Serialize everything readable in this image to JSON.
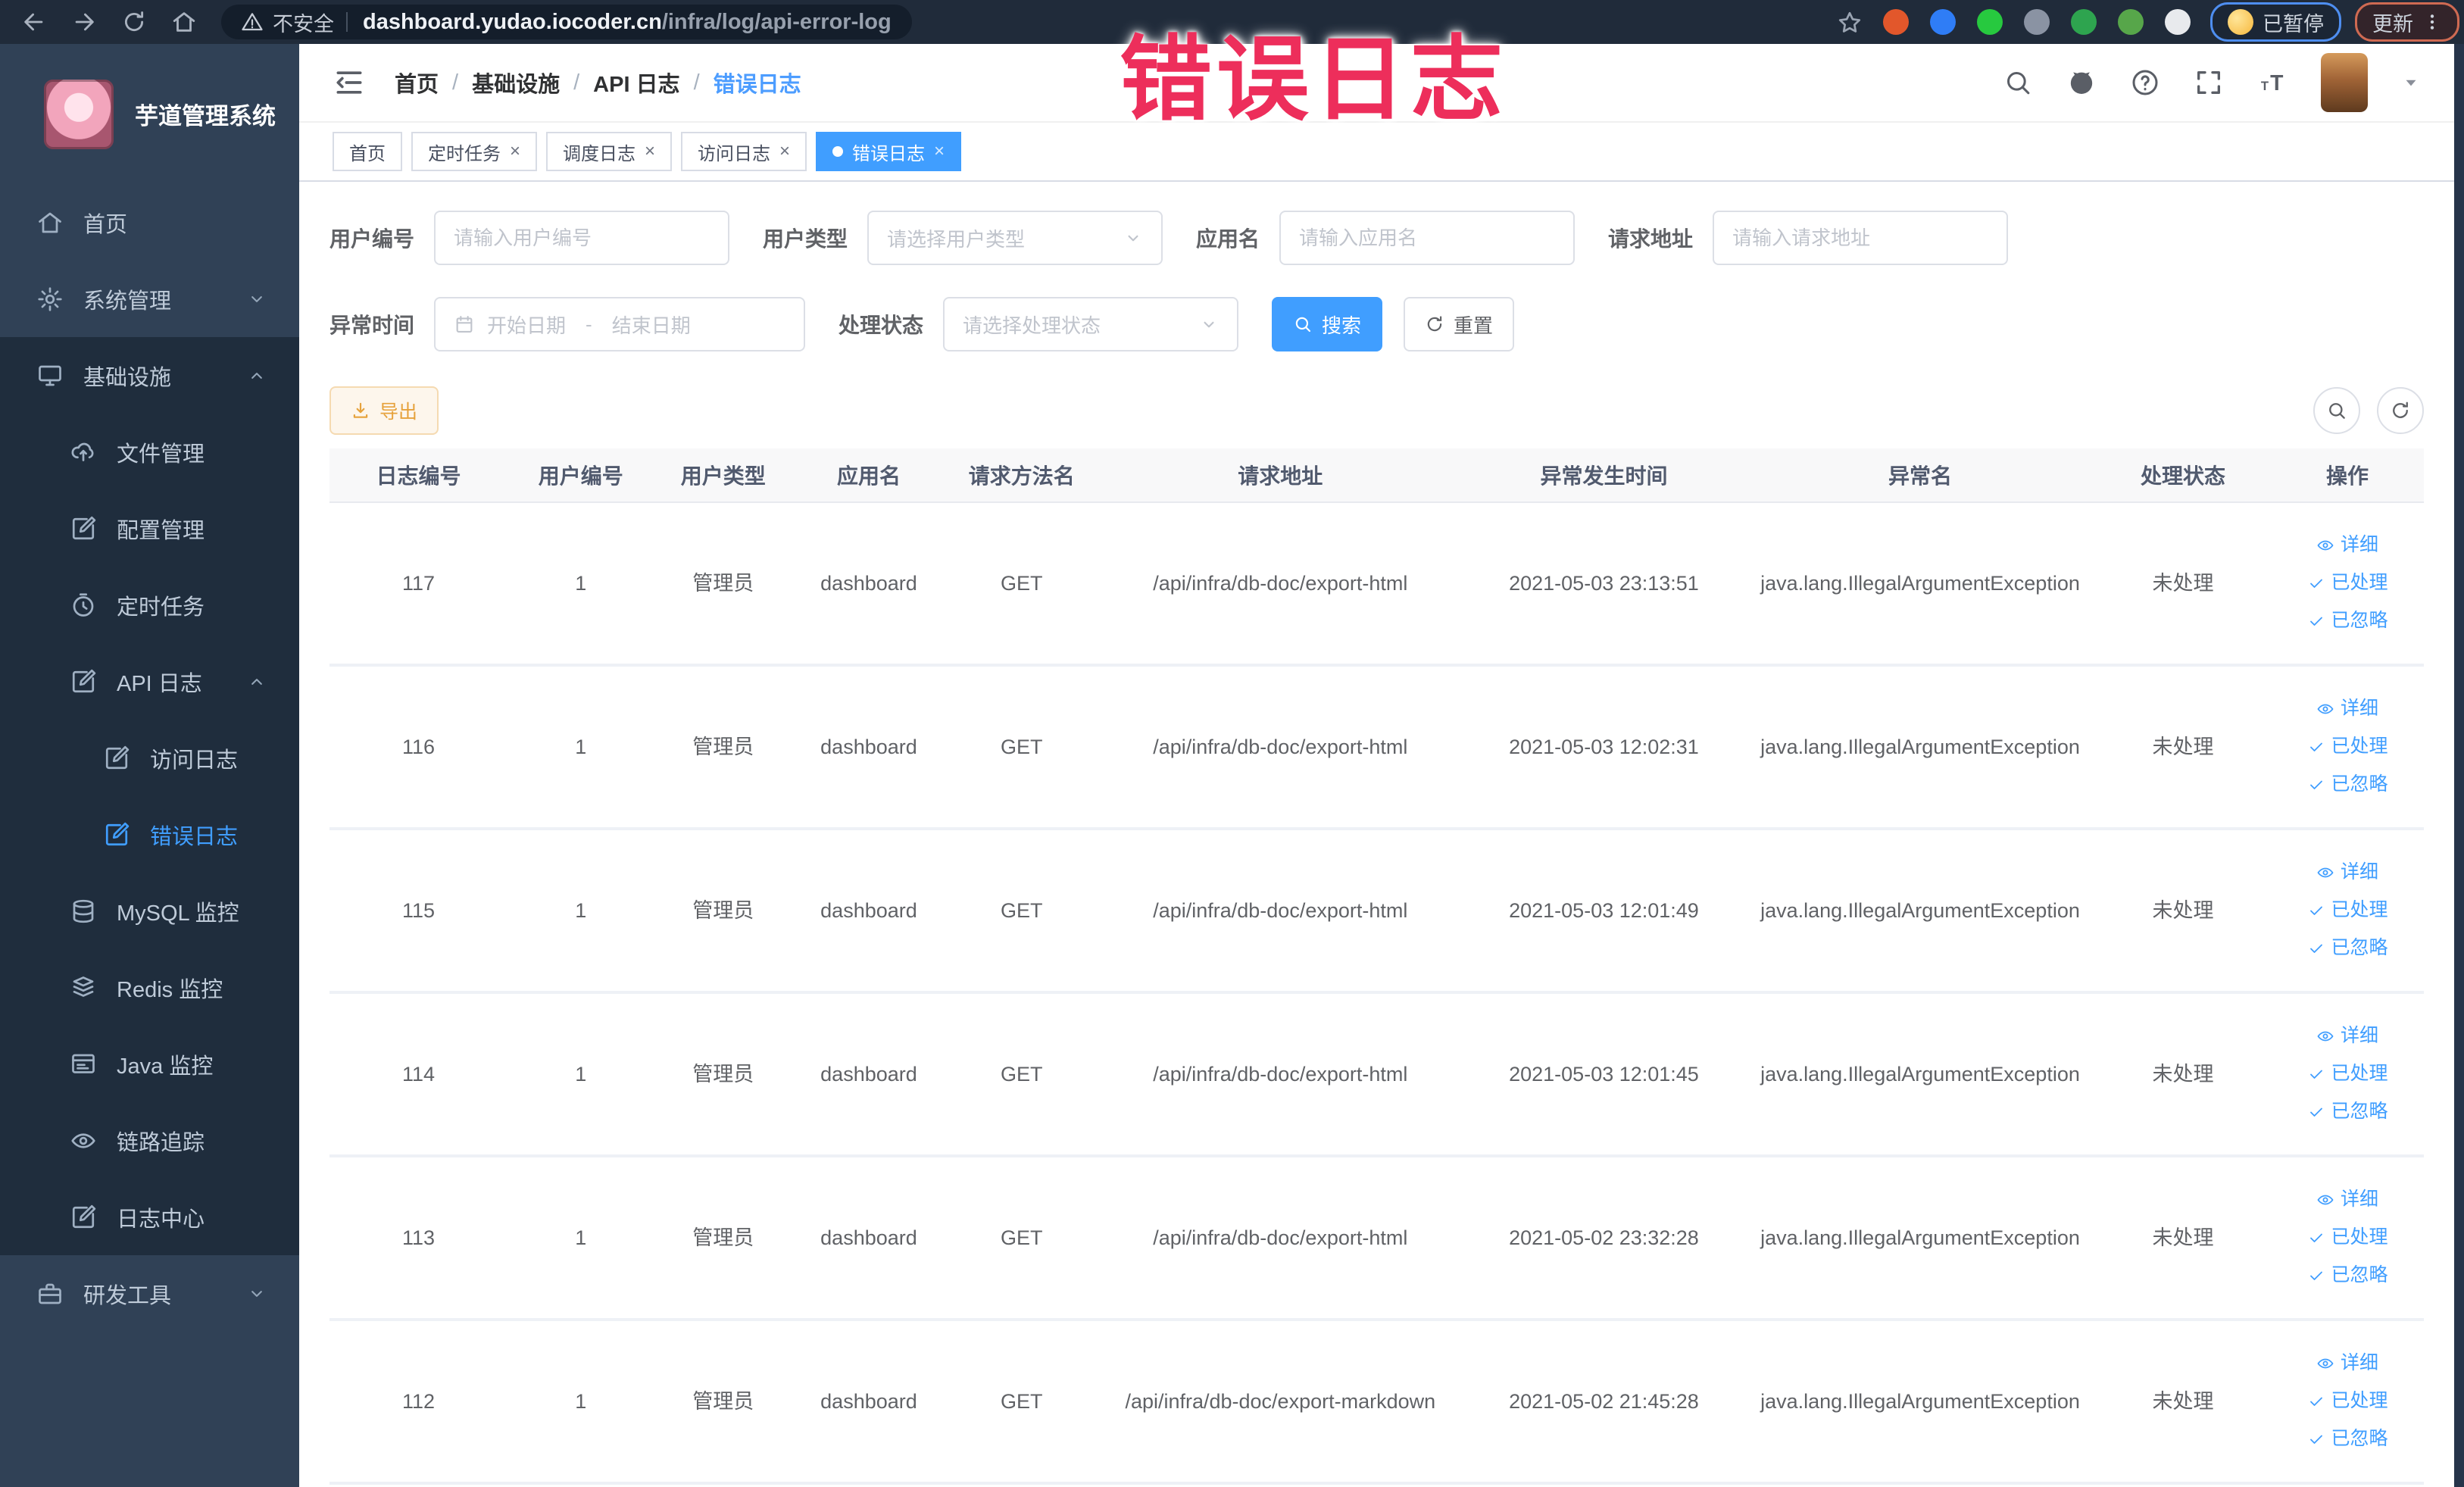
{
  "browser": {
    "security_label": "不安全",
    "url_host": "dashboard.yudao.iocoder.cn",
    "url_path": "/infra/log/api-error-log",
    "paused_badge": "已暂停",
    "update_button": "更新",
    "extension_icons": [
      {
        "name": "bookmark-star-icon",
        "color": "#9aa4b2"
      },
      {
        "name": "extension-orange-icon",
        "color": "#e2572b"
      },
      {
        "name": "extension-shield-icon",
        "color": "#2f7df6"
      },
      {
        "name": "extension-green-icon",
        "color": "#27c93f"
      },
      {
        "name": "extension-grid-icon",
        "color": "#8a93a3"
      },
      {
        "name": "extension-git-icon",
        "color": "#2ea44f"
      },
      {
        "name": "extension-leaf-icon",
        "color": "#57a64a"
      },
      {
        "name": "extension-puzzle-icon",
        "color": "#e8eaed"
      }
    ]
  },
  "overlay": {
    "text": "错误日志",
    "color": "#ed2e5b"
  },
  "sidebar": {
    "app_title": "芋道管理系统",
    "items": [
      {
        "label": "首页",
        "level": 1,
        "icon": "home"
      },
      {
        "label": "系统管理",
        "level": 1,
        "icon": "gear",
        "chevron": "down"
      },
      {
        "label": "基础设施",
        "level": 1,
        "icon": "monitor",
        "chevron": "up",
        "in_open_section": true
      },
      {
        "label": "文件管理",
        "level": 2,
        "icon": "cloud",
        "in_open_section": true
      },
      {
        "label": "配置管理",
        "level": 2,
        "icon": "edit",
        "in_open_section": true
      },
      {
        "label": "定时任务",
        "level": 2,
        "icon": "timer",
        "in_open_section": true
      },
      {
        "label": "API 日志",
        "level": 2,
        "icon": "edit",
        "chevron": "up",
        "in_open_section": true
      },
      {
        "label": "访问日志",
        "level": 3,
        "icon": "edit",
        "in_open_section": true
      },
      {
        "label": "错误日志",
        "level": 3,
        "icon": "edit",
        "active": true,
        "in_open_section": true
      },
      {
        "label": "MySQL 监控",
        "level": 2,
        "icon": "db",
        "in_open_section": true
      },
      {
        "label": "Redis 监控",
        "level": 2,
        "icon": "redis",
        "in_open_section": true
      },
      {
        "label": "Java 监控",
        "level": 2,
        "icon": "java",
        "in_open_section": true
      },
      {
        "label": "链路追踪",
        "level": 2,
        "icon": "eye",
        "in_open_section": true
      },
      {
        "label": "日志中心",
        "level": 2,
        "icon": "edit",
        "in_open_section": true
      },
      {
        "label": "研发工具",
        "level": 1,
        "icon": "tools",
        "chevron": "down"
      }
    ]
  },
  "header": {
    "breadcrumb": [
      "首页",
      "基础设施",
      "API 日志",
      "错误日志"
    ]
  },
  "tabs": [
    {
      "label": "首页",
      "closable": false,
      "active": false
    },
    {
      "label": "定时任务",
      "closable": true,
      "active": false
    },
    {
      "label": "调度日志",
      "closable": true,
      "active": false
    },
    {
      "label": "访问日志",
      "closable": true,
      "active": false
    },
    {
      "label": "错误日志",
      "closable": true,
      "active": true
    }
  ],
  "filters": {
    "user_id": {
      "label": "用户编号",
      "placeholder": "请输入用户编号"
    },
    "user_type": {
      "label": "用户类型",
      "placeholder": "请选择用户类型"
    },
    "app_name": {
      "label": "应用名",
      "placeholder": "请输入应用名"
    },
    "request_url": {
      "label": "请求地址",
      "placeholder": "请输入请求地址"
    },
    "exception_time": {
      "label": "异常时间",
      "start_placeholder": "开始日期",
      "separator": "-",
      "end_placeholder": "结束日期"
    },
    "process_status": {
      "label": "处理状态",
      "placeholder": "请选择处理状态"
    },
    "search_button": "搜索",
    "reset_button": "重置"
  },
  "toolbar": {
    "export_button": "导出"
  },
  "table": {
    "columns": [
      "日志编号",
      "用户编号",
      "用户类型",
      "应用名",
      "请求方法名",
      "请求地址",
      "异常发生时间",
      "异常名",
      "处理状态",
      "操作"
    ],
    "actions": {
      "detail": "详细",
      "processed": "已处理",
      "ignored": "已忽略"
    },
    "rows": [
      {
        "id": "117",
        "user_id": "1",
        "user_type": "管理员",
        "app": "dashboard",
        "method": "GET",
        "url": "/api/infra/db-doc/export-html",
        "time": "2021-05-03 23:13:51",
        "exception": "java.lang.IllegalArgumentException",
        "status": "未处理"
      },
      {
        "id": "116",
        "user_id": "1",
        "user_type": "管理员",
        "app": "dashboard",
        "method": "GET",
        "url": "/api/infra/db-doc/export-html",
        "time": "2021-05-03 12:02:31",
        "exception": "java.lang.IllegalArgumentException",
        "status": "未处理"
      },
      {
        "id": "115",
        "user_id": "1",
        "user_type": "管理员",
        "app": "dashboard",
        "method": "GET",
        "url": "/api/infra/db-doc/export-html",
        "time": "2021-05-03 12:01:49",
        "exception": "java.lang.IllegalArgumentException",
        "status": "未处理"
      },
      {
        "id": "114",
        "user_id": "1",
        "user_type": "管理员",
        "app": "dashboard",
        "method": "GET",
        "url": "/api/infra/db-doc/export-html",
        "time": "2021-05-03 12:01:45",
        "exception": "java.lang.IllegalArgumentException",
        "status": "未处理"
      },
      {
        "id": "113",
        "user_id": "1",
        "user_type": "管理员",
        "app": "dashboard",
        "method": "GET",
        "url": "/api/infra/db-doc/export-html",
        "time": "2021-05-02 23:32:28",
        "exception": "java.lang.IllegalArgumentException",
        "status": "未处理"
      },
      {
        "id": "112",
        "user_id": "1",
        "user_type": "管理员",
        "app": "dashboard",
        "method": "GET",
        "url": "/api/infra/db-doc/export-markdown",
        "time": "2021-05-02 21:45:28",
        "exception": "java.lang.IllegalArgumentException",
        "status": "未处理"
      }
    ]
  }
}
